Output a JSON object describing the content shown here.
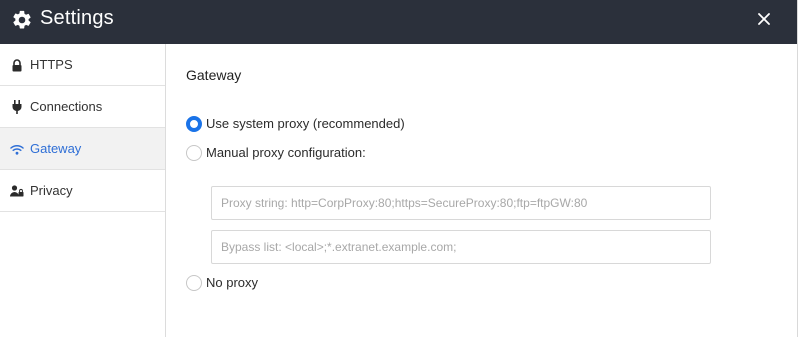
{
  "header": {
    "title": "Settings",
    "settings_icon": "gear-icon",
    "close_icon": "close-icon",
    "background": "#2b303b"
  },
  "sidebar": {
    "items": [
      {
        "label": "HTTPS",
        "icon": "lock-icon",
        "active": false
      },
      {
        "label": "Connections",
        "icon": "plug-icon",
        "active": false
      },
      {
        "label": "Gateway",
        "icon": "wifi-icon",
        "active": true
      },
      {
        "label": "Privacy",
        "icon": "user-lock-icon",
        "active": false
      }
    ],
    "active_color": "#2f6fd6"
  },
  "main": {
    "section_title": "Gateway",
    "options": [
      {
        "label": "Use system proxy (recommended)",
        "checked": true
      },
      {
        "label": "Manual proxy configuration:",
        "checked": false
      },
      {
        "label": "No proxy",
        "checked": false
      }
    ],
    "proxy_string": {
      "value": "",
      "placeholder": "Proxy string: http=CorpProxy:80;https=SecureProxy:80;ftp=ftpGW:80"
    },
    "bypass_list": {
      "value": "",
      "placeholder": "Bypass list: <local>;*.extranet.example.com;"
    },
    "accent_color": "#1a73e8"
  }
}
